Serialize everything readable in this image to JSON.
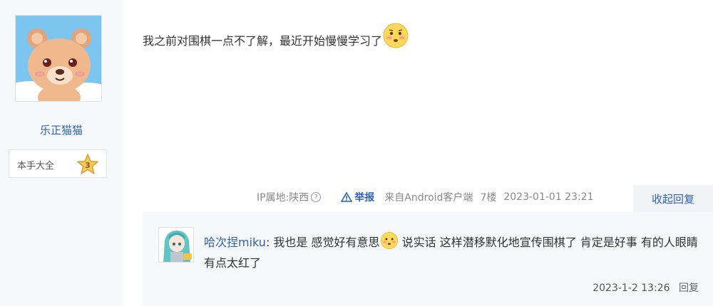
{
  "author": {
    "username": "乐正猫猫",
    "rank_title": "本手大全",
    "rank_level": "3"
  },
  "post": {
    "text": "我之前对围棋一点不了解，最近开始慢慢学习了"
  },
  "meta": {
    "ip_location": "IP属地:陕西",
    "question_mark": "?",
    "report_label": "举报",
    "source": "来自Android客户端",
    "floor": "7楼",
    "timestamp": "2023-01-01 23:21",
    "collapse_reply_label": "收起回复"
  },
  "reply": {
    "username": "哈次捏miku",
    "separator": ":",
    "text_before_emoji": " 我也是 感觉好有意思",
    "text_after_emoji": " 说实话 这样潜移默化地宣传围棋了 肯定是好事 有的人眼睛有点太红了",
    "timestamp": "2023-1-2 13:26",
    "reply_label": "回复"
  },
  "colors": {
    "link_blue": "#2d64b3",
    "sidebar_bg": "#f7f8fa",
    "reply_bg": "#f7f8fa"
  },
  "icons": {
    "avatar": "bear-avatar-icon",
    "rank": "star-badge-icon",
    "emoji": "shy-face-emoji-icon",
    "report": "warning-triangle-icon",
    "reply_avatar": "anime-girl-avatar-icon"
  }
}
